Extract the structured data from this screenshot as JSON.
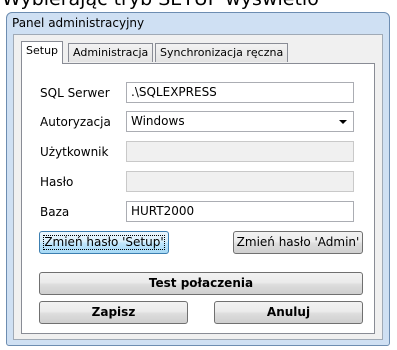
{
  "top_text": "Wybierając tryb SETUP wyświetlo",
  "window": {
    "title": "Panel administracyjny"
  },
  "tabs": [
    {
      "label": "Setup"
    },
    {
      "label": "Administracja"
    },
    {
      "label": "Synchronizacja ręczna"
    }
  ],
  "form": {
    "sql_server": {
      "label": "SQL Serwer",
      "value": ".\\SQLEXPRESS"
    },
    "auth": {
      "label": "Autoryzacja",
      "value": "Windows"
    },
    "user": {
      "label": "Użytkownik",
      "value": ""
    },
    "password": {
      "label": "Hasło",
      "value": ""
    },
    "database": {
      "label": "Baza",
      "value": "HURT2000"
    }
  },
  "buttons": {
    "change_setup": "Zmień hasło 'Setup'",
    "change_admin": "Zmień hasło 'Admin'",
    "test": "Test połaczenia",
    "save": "Zapisz",
    "cancel": "Anuluj"
  },
  "icons": {
    "combo_arrow": "chevron-down-icon"
  }
}
